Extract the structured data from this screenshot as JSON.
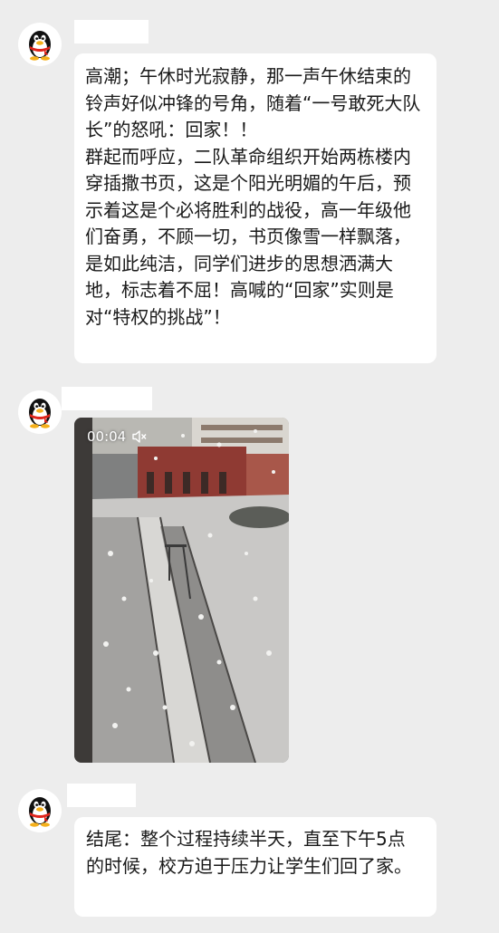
{
  "messages": [
    {
      "type": "text",
      "text": "高潮；午休时光寂静，那一声午休结束的铃声好似冲锋的号角，随着“一号敢死大队长”的怒吼：回家！！\n群起而呼应，二队革命组织开始两栋楼内穿插撒书页，这是个阳光明媚的午后，预示着这是个必将胜利的战役，高一年级他们奋勇，不顾一切，书页像雪一样飘落，是如此纯洁，同学们进步的思想洒满大地，标志着不屈！高喊的“回家”实则是对“特权的挑战”！"
    },
    {
      "type": "video",
      "duration": "00:04",
      "muted_icon": "speaker-muted-icon"
    },
    {
      "type": "text",
      "text": "结尾：整个过程持续半天，直至下午5点的时候，校方迫于压力让学生们回了家。"
    }
  ],
  "colors": {
    "background": "#ededed",
    "bubble": "#ffffff",
    "text": "#1a1a1a",
    "avatar_scarf": "#e0251b",
    "avatar_beak": "#f5b01b"
  },
  "avatar_icon": "qq-penguin-icon"
}
